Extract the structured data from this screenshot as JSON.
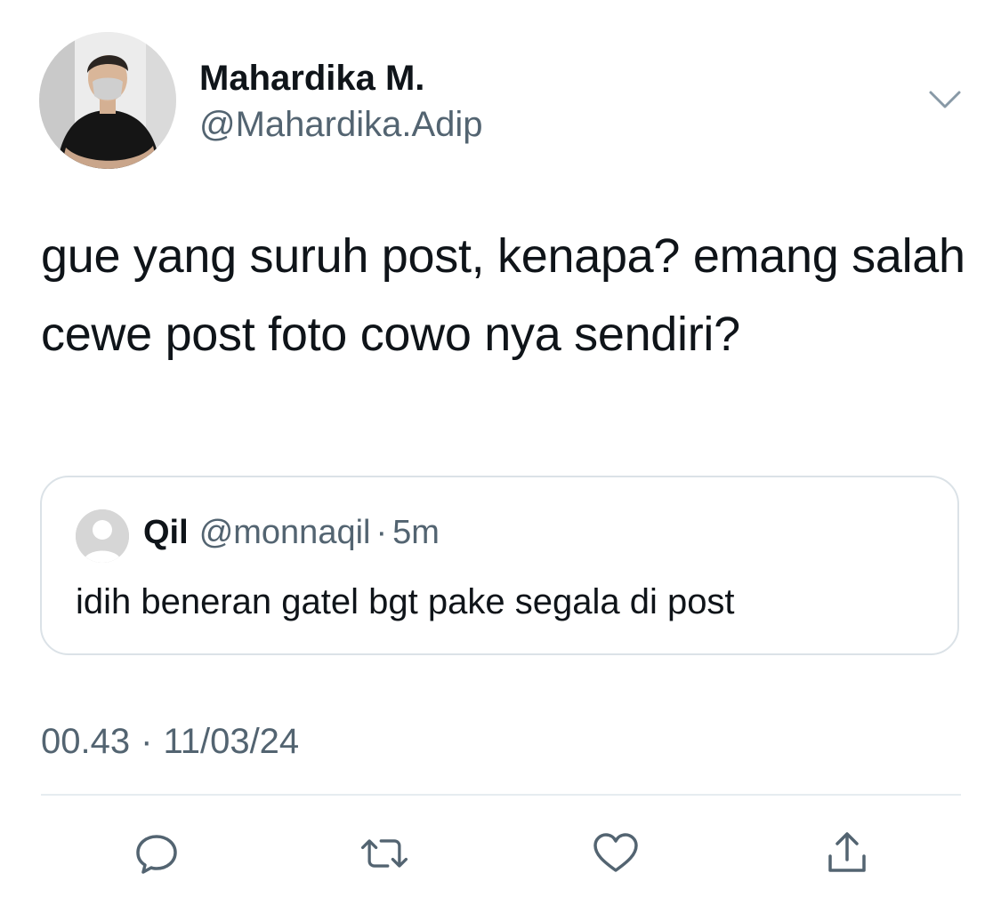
{
  "author": {
    "display_name": "Mahardika M.",
    "handle": "@Mahardika.Adip",
    "avatar_icon": "profile-photo"
  },
  "tweet": {
    "text": "gue yang suruh post, kenapa? emang salah cewe post foto cowo nya sendiri?"
  },
  "quoted_tweet": {
    "display_name": "Qil",
    "handle": "@monnaqil",
    "separator": "·",
    "time": "5m",
    "text": "idih beneran gatel bgt pake segala di post",
    "avatar_icon": "default-avatar-icon"
  },
  "timestamp": {
    "time": "00.43",
    "separator": "·",
    "date": "11/03/24"
  },
  "actions": [
    {
      "name": "reply",
      "icon": "reply-icon"
    },
    {
      "name": "retweet",
      "icon": "retweet-icon"
    },
    {
      "name": "like",
      "icon": "heart-icon"
    },
    {
      "name": "share",
      "icon": "share-icon"
    }
  ],
  "colors": {
    "primary_text": "#0f1419",
    "secondary_text": "#536471",
    "border": "#dbe2e7",
    "icon": "#536471"
  }
}
